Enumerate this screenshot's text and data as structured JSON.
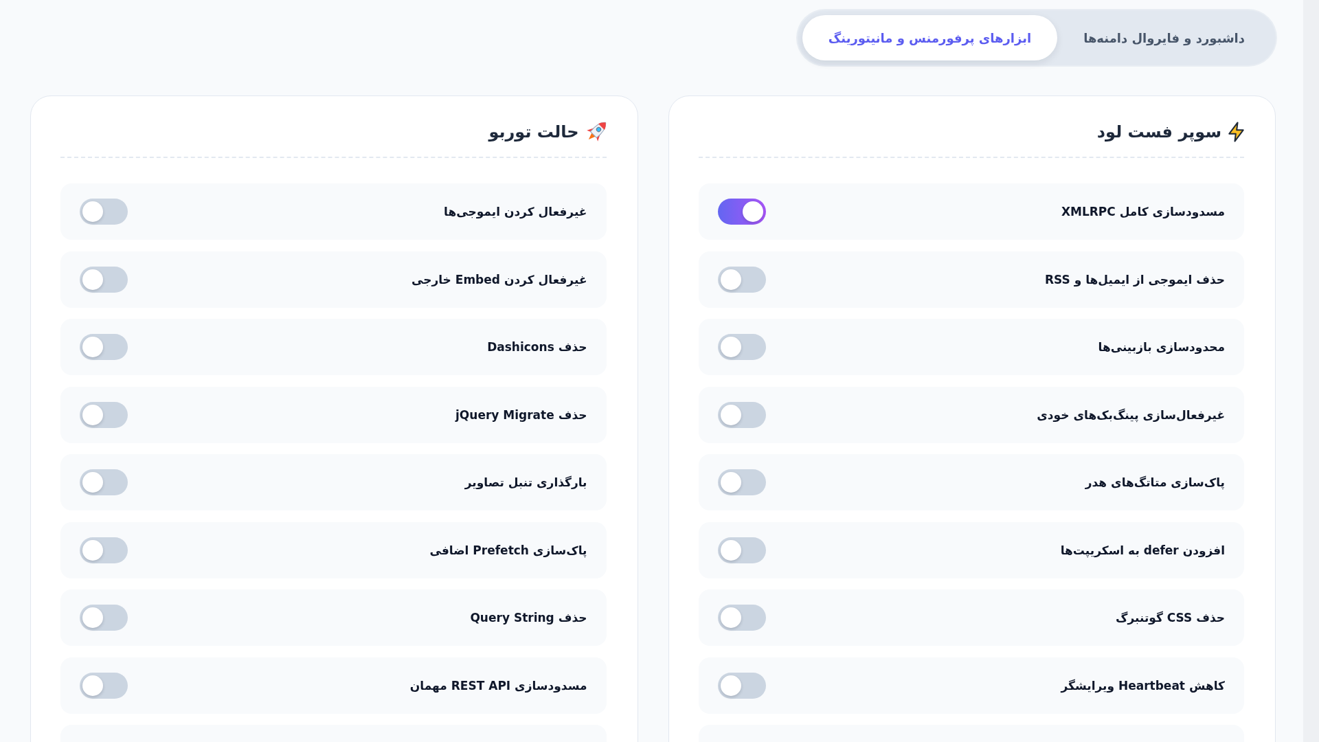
{
  "tabs": [
    {
      "label": "داشبورد و فایروال دامنه‌ها",
      "selected": false
    },
    {
      "label": "ابزارهای پرفورمنس و مانیتورینگ",
      "selected": true
    }
  ],
  "cards": [
    {
      "title": "سوپر فست لود",
      "rows_continue_below": true,
      "items": [
        {
          "label": "مسدودسازی کامل XMLRPC",
          "on": true
        },
        {
          "label": "حذف ایموجی از ایمیل‌ها و RSS",
          "on": false
        },
        {
          "label": "محدودسازی بازبینی‌ها",
          "on": false
        },
        {
          "label": "غیرفعال‌سازی پینگ‌بک‌های خودی",
          "on": false
        },
        {
          "label": "پاک‌سازی متاتگ‌های هدر",
          "on": false
        },
        {
          "label": "افزودن defer به اسکریپت‌ها",
          "on": false
        },
        {
          "label": "حذف CSS گوتنبرگ",
          "on": false
        },
        {
          "label": "کاهش Heartbeat ویرایشگر",
          "on": false
        }
      ]
    },
    {
      "title": "حالت توربو",
      "rows_continue_below": true,
      "items": [
        {
          "label": "غیرفعال کردن ایموجی‌ها",
          "on": false
        },
        {
          "label": "غیرفعال کردن Embed خارجی",
          "on": false
        },
        {
          "label": "حذف Dashicons",
          "on": false
        },
        {
          "label": "حذف jQuery Migrate",
          "on": false
        },
        {
          "label": "بارگذاری تنبل تصاویر",
          "on": false
        },
        {
          "label": "پاک‌سازی Prefetch اضافی",
          "on": false
        },
        {
          "label": "حذف Query String",
          "on": false
        },
        {
          "label": "مسدودسازی REST API مهمان",
          "on": false
        }
      ]
    }
  ]
}
